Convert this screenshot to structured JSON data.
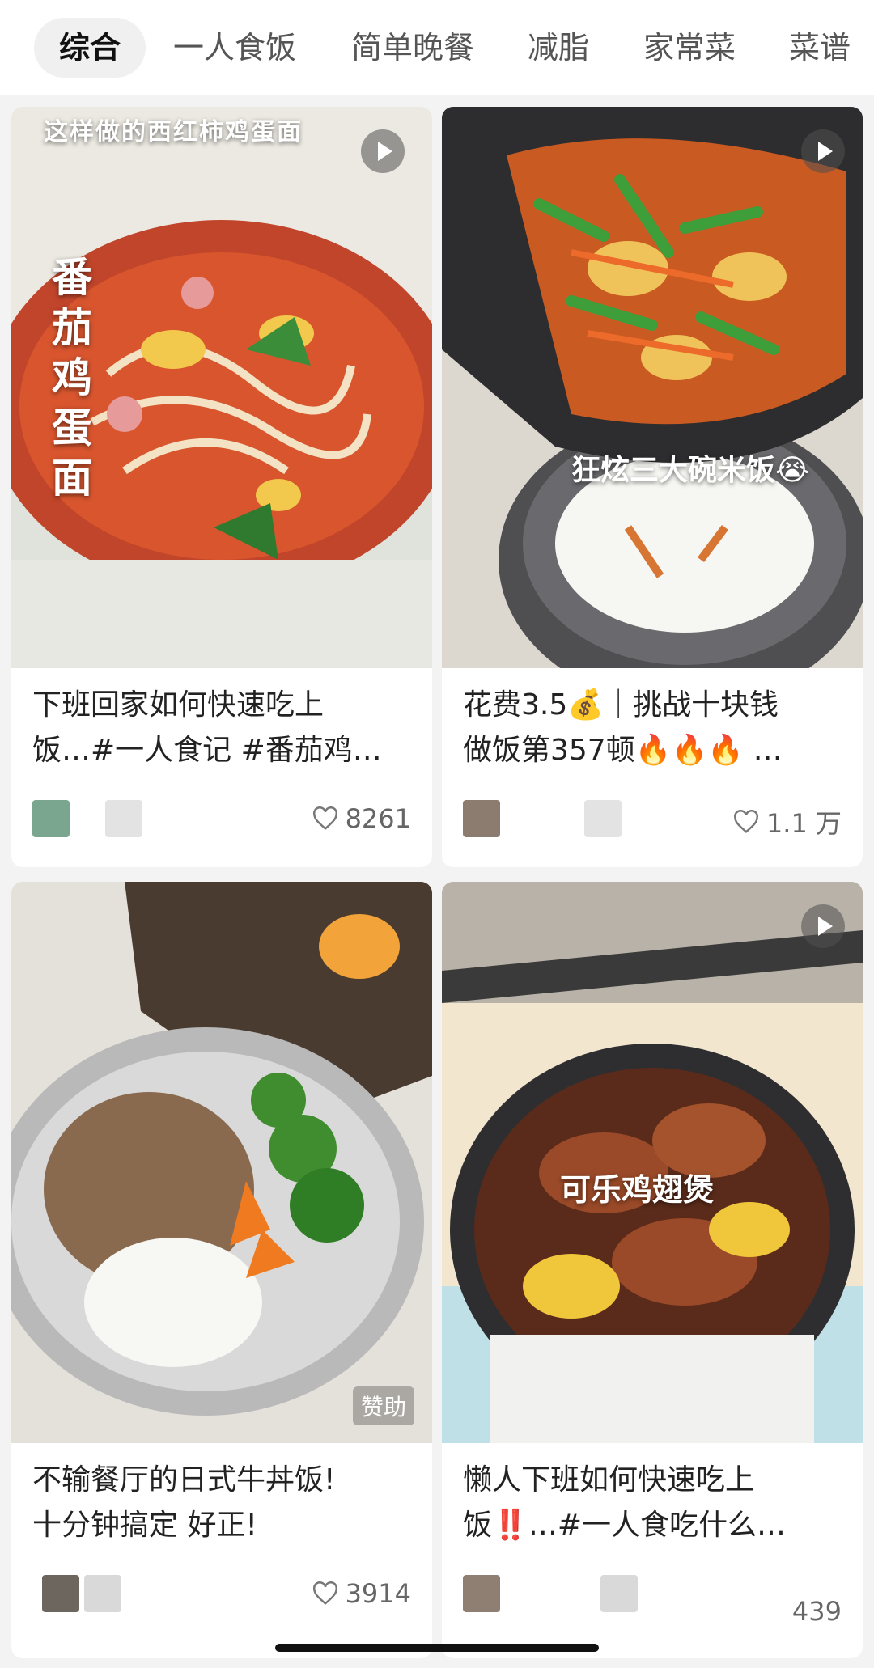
{
  "tabs": [
    {
      "label": "综合",
      "active": true
    },
    {
      "label": "一人食饭"
    },
    {
      "label": "简单晚餐"
    },
    {
      "label": "减脂"
    },
    {
      "label": "家常菜"
    },
    {
      "label": "菜谱"
    }
  ],
  "cards": [
    {
      "image_caption_top": "这样做的西红柿鸡蛋面",
      "image_caption_vertical": "番茄鸡蛋面",
      "title_line1": "下班回家如何快速吃上",
      "title_line2": "饭…#一人食记 #番茄鸡…",
      "likes": "8261",
      "is_video": true
    },
    {
      "image_caption": "狂炫三大碗米饭😭",
      "title_line1": "花费3.5💰｜挑战十块钱",
      "title_line2": "做饭第357顿🔥🔥🔥 …",
      "likes": "1.1 万",
      "is_video": true
    },
    {
      "title_line1": "不输餐厅的日式牛丼饭!",
      "title_line2": "十分钟搞定 好正!",
      "likes": "3914",
      "sponsor_label": "赞助"
    },
    {
      "image_caption": "可乐鸡翅煲",
      "title_line1": "懒人下班如何快速吃上",
      "title_line2": "饭‼️…#一人食吃什么…",
      "likes": "439",
      "is_video": true
    }
  ],
  "colors": {
    "background": "#f3f3f3",
    "card": "#ffffff",
    "active_tab_bg": "#f0f0f0"
  }
}
